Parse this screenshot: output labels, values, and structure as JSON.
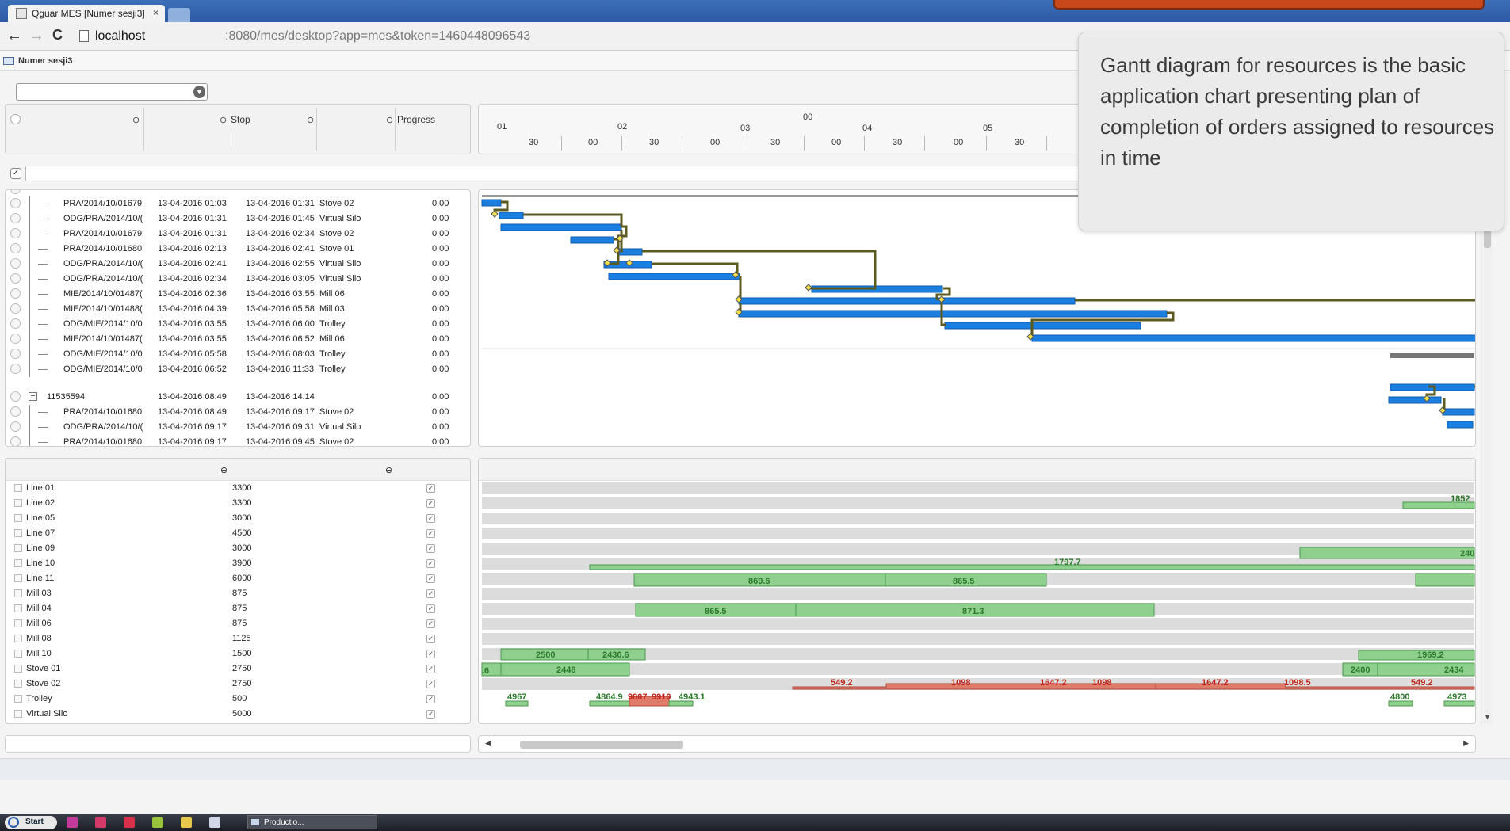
{
  "browser": {
    "tab_title": "Qguar MES [Numer sesji3]",
    "tab_close": "×",
    "back": "←",
    "forward": "→",
    "reload": "C",
    "url_host": "localhost",
    "url_path": ":8080/mes/desktop?app=mes&token=1460448096543"
  },
  "app": {
    "title": "Numer sesji3"
  },
  "task_grid": {
    "columns": [
      "",
      "",
      "Stop",
      "",
      "Progress"
    ],
    "rows": [
      {
        "name": "PRA/2014/10/01679",
        "start": "13-04-2016 01:03",
        "stop": "13-04-2016 01:31",
        "resource": "Stove 02",
        "progress": "0.00"
      },
      {
        "name": "ODG/PRA/2014/10/(",
        "start": "13-04-2016 01:31",
        "stop": "13-04-2016 01:45",
        "resource": "Virtual Silo",
        "progress": "0.00"
      },
      {
        "name": "PRA/2014/10/01679",
        "start": "13-04-2016 01:31",
        "stop": "13-04-2016 02:34",
        "resource": "Stove 02",
        "progress": "0.00"
      },
      {
        "name": "PRA/2014/10/01680",
        "start": "13-04-2016 02:13",
        "stop": "13-04-2016 02:41",
        "resource": "Stove 01",
        "progress": "0.00"
      },
      {
        "name": "ODG/PRA/2014/10/(",
        "start": "13-04-2016 02:41",
        "stop": "13-04-2016 02:55",
        "resource": "Virtual Silo",
        "progress": "0.00"
      },
      {
        "name": "ODG/PRA/2014/10/(",
        "start": "13-04-2016 02:34",
        "stop": "13-04-2016 03:05",
        "resource": "Virtual Silo",
        "progress": "0.00"
      },
      {
        "name": "MIE/2014/10/01487(",
        "start": "13-04-2016 02:36",
        "stop": "13-04-2016 03:55",
        "resource": "Mill 06",
        "progress": "0.00"
      },
      {
        "name": "MIE/2014/10/01488(",
        "start": "13-04-2016 04:39",
        "stop": "13-04-2016 05:58",
        "resource": "Mill 03",
        "progress": "0.00"
      },
      {
        "name": "ODG/MIE/2014/10/0",
        "start": "13-04-2016 03:55",
        "stop": "13-04-2016 06:00",
        "resource": "Trolley",
        "progress": "0.00"
      },
      {
        "name": "MIE/2014/10/01487(",
        "start": "13-04-2016 03:55",
        "stop": "13-04-2016 06:52",
        "resource": "Mill 06",
        "progress": "0.00"
      },
      {
        "name": "ODG/MIE/2014/10/0",
        "start": "13-04-2016 05:58",
        "stop": "13-04-2016 08:03",
        "resource": "Trolley",
        "progress": "0.00"
      },
      {
        "name": "ODG/MIE/2014/10/0",
        "start": "13-04-2016 06:52",
        "stop": "13-04-2016 11:33",
        "resource": "Trolley",
        "progress": "0.00"
      }
    ],
    "group": {
      "expander": "−",
      "name": "11535594",
      "start": "13-04-2016 08:49",
      "stop": "13-04-2016 14:14",
      "progress": "0.00"
    },
    "group_rows": [
      {
        "name": "PRA/2014/10/01680",
        "start": "13-04-2016 08:49",
        "stop": "13-04-2016 09:17",
        "resource": "Stove 02",
        "progress": "0.00"
      },
      {
        "name": "ODG/PRA/2014/10/(",
        "start": "13-04-2016 09:17",
        "stop": "13-04-2016 09:31",
        "resource": "Virtual Silo",
        "progress": "0.00"
      },
      {
        "name": "PRA/2014/10/01680",
        "start": "13-04-2016 09:17",
        "stop": "13-04-2016 09:45",
        "resource": "Stove 02",
        "progress": "0.00"
      }
    ]
  },
  "timeline": {
    "hours": [
      "01",
      "02",
      "03",
      "04",
      "05"
    ],
    "day": "00",
    "minutes": [
      "30",
      "00",
      "30",
      "00",
      "30",
      "00",
      "30",
      "00",
      "30"
    ]
  },
  "resources": [
    {
      "name": "Line 01",
      "capacity": "3300"
    },
    {
      "name": "Line 02",
      "capacity": "3300"
    },
    {
      "name": "Line 05",
      "capacity": "3000"
    },
    {
      "name": "Line 07",
      "capacity": "4500"
    },
    {
      "name": "Line 09",
      "capacity": "3000"
    },
    {
      "name": "Line 10",
      "capacity": "3900"
    },
    {
      "name": "Line 11",
      "capacity": "6000"
    },
    {
      "name": "Mill 03",
      "capacity": "875"
    },
    {
      "name": "Mill 04",
      "capacity": "875"
    },
    {
      "name": "Mill 06",
      "capacity": "875"
    },
    {
      "name": "Mill 08",
      "capacity": "1125"
    },
    {
      "name": "Mill 10",
      "capacity": "1500"
    },
    {
      "name": "Stove 01",
      "capacity": "2750"
    },
    {
      "name": "Stove 02",
      "capacity": "2750"
    },
    {
      "name": "Trolley",
      "capacity": "500"
    },
    {
      "name": "Virtual Silo",
      "capacity": "5000"
    }
  ],
  "load_labels": {
    "line02": "1852",
    "line09": "240",
    "line10": "1797.7",
    "mill03_a": "869.6",
    "mill03_b": "865.5",
    "mill06_a": "865.5",
    "mill06_b": "871.3",
    "stove01_a": "2500",
    "stove01_b": "2430.6",
    "stove01_c": "1969.2",
    "stove02_a": ".6",
    "stove02_b": "2448",
    "stove02_c": "2400",
    "stove02_d": "2434",
    "trolley": [
      "549.2",
      "1098",
      "1647.2",
      "1098",
      "1647.2",
      "1098.5",
      "549.2"
    ],
    "silo": [
      "4967",
      "4864.9",
      "9807",
      "9910",
      "4943.1",
      "4800",
      "4973"
    ]
  },
  "callout": {
    "text": "Gantt diagram for resources is the basic application chart presenting plan of completion of orders assigned to resources in time"
  },
  "taskbar": {
    "start": "Start",
    "task": "Productio..."
  },
  "colors": {
    "task_bar": "#1b7fe0",
    "link": "#5c5a1f",
    "load_ok": "#8fd08f",
    "load_over": "#e07a6a",
    "load_label_ok": "#2a7a2a",
    "load_label_over": "#c0251a"
  }
}
